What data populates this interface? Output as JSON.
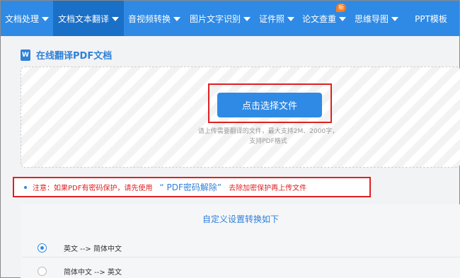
{
  "nav": {
    "items": [
      {
        "label": "文档处理",
        "caret": true,
        "active": false
      },
      {
        "label": "文档文本翻译",
        "caret": true,
        "active": true
      },
      {
        "label": "音视频转换",
        "caret": true,
        "active": false
      },
      {
        "label": "图片文字识别",
        "caret": true,
        "active": false
      },
      {
        "label": "证件照",
        "caret": true,
        "active": false
      },
      {
        "label": "论文查重",
        "caret": true,
        "active": false,
        "badge": "新"
      },
      {
        "label": "思维导图",
        "caret": true,
        "active": false
      },
      {
        "label": "PPT模板",
        "caret": false,
        "active": false
      }
    ]
  },
  "page": {
    "title": "在线翻译PDF文档",
    "title_icon_letter": "W"
  },
  "upload": {
    "button_label": "点击选择文件",
    "hint_line1": "请上传需要翻译的文件，最大支持2M、2000字，",
    "hint_line2": "支持PDF格式"
  },
  "notice": {
    "prefix": "注意：如果PDF有密码保护，请先使用",
    "link": "“ PDF密码解除”",
    "suffix": "去除加密保护再上传文件"
  },
  "settings": {
    "title": "自定义设置转换如下",
    "options": [
      {
        "label": "英文 --> 简体中文",
        "checked": true
      },
      {
        "label": "简体中文 --> 英文",
        "checked": false
      }
    ]
  },
  "colors": {
    "nav_bg": "#2f8ae5",
    "nav_active": "#1a6fc7",
    "accent": "#2f80d8",
    "warning": "#e02020",
    "badge": "#ff7a1a"
  }
}
